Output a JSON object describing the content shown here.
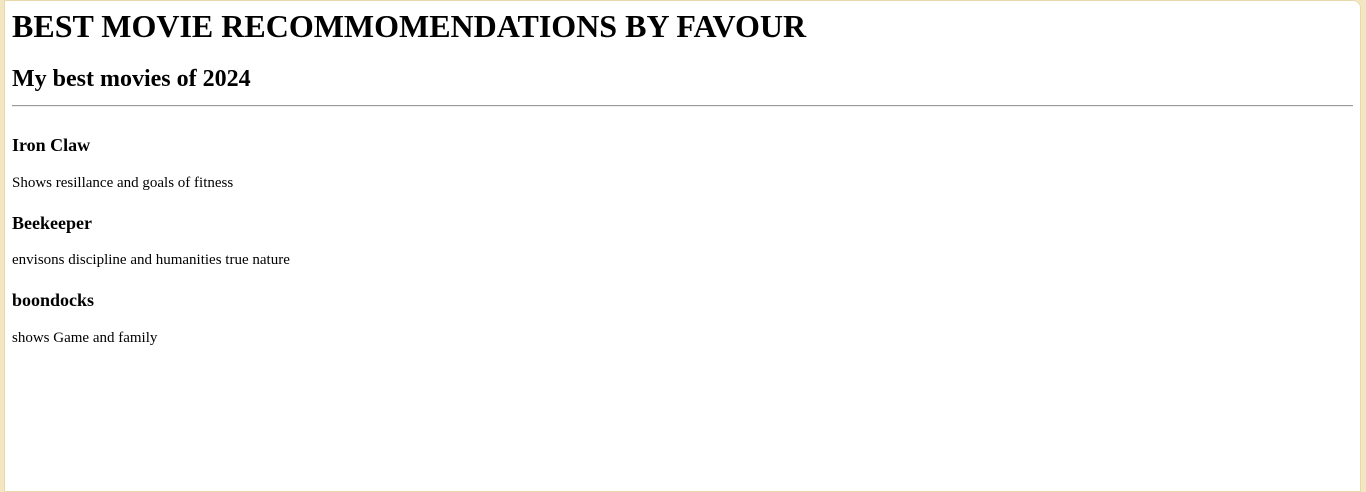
{
  "page": {
    "title": "BEST MOVIE RECOMMOMENDATIONS BY FAVOUR",
    "subtitle": "My best movies of 2024"
  },
  "movies": [
    {
      "title": "Iron Claw",
      "description": "Shows resillance and goals of fitness"
    },
    {
      "title": "Beekeeper",
      "description": "envisons discipline and humanities true nature"
    },
    {
      "title": "boondocks",
      "description": "shows Game and family"
    }
  ],
  "colors": {
    "page_background": "#f3e6c2",
    "content_background": "#ffffff",
    "text": "#000000",
    "divider": "#9a9a9a"
  }
}
